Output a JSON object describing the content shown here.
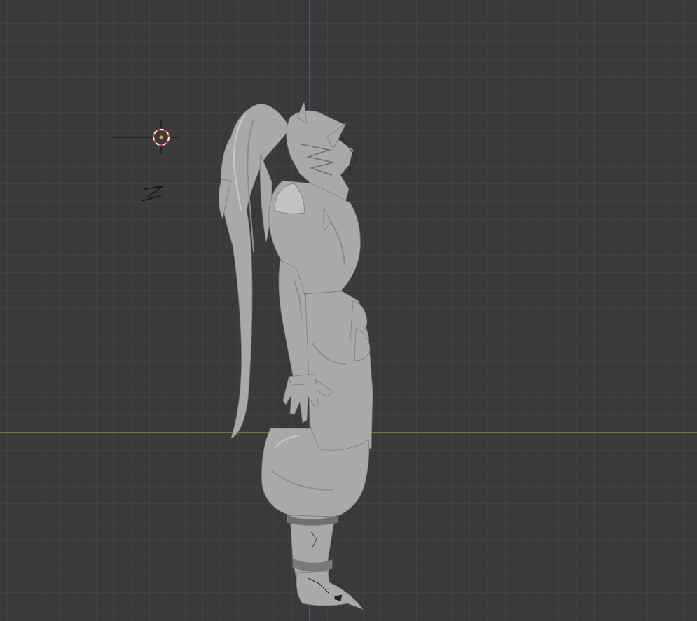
{
  "viewport": {
    "view": "side-orthographic",
    "grid": true,
    "colors": {
      "background": "#3a3a3a",
      "grid_minor": "#444444",
      "grid_major": "#4d4d4d",
      "axis_x": "#6f9a3a",
      "axis_z": "#3f6fae",
      "mesh_fill": "#a9a9a9",
      "mesh_shadow": "#8c8c8c",
      "mesh_highlight": "#c2c2c2",
      "cursor_red": "#e0403a",
      "cursor_white": "#f2f2f2"
    },
    "icons": [
      "3d-cursor-icon",
      "light-object-icon"
    ]
  }
}
